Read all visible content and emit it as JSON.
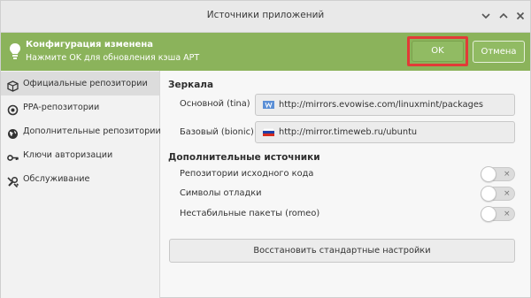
{
  "window": {
    "title": "Источники приложений"
  },
  "infobar": {
    "heading": "Конфигурация изменена",
    "message": "Нажмите OK для обновления кэша APT",
    "ok_label": "OK",
    "cancel_label": "Отмена",
    "color": "#8bb35b",
    "highlight_color": "#e23b37"
  },
  "sidebar": {
    "items": [
      {
        "label": "Официальные репозитории",
        "icon": "box-icon",
        "active": true
      },
      {
        "label": "PPA-репозитории",
        "icon": "target-icon",
        "active": false
      },
      {
        "label": "Дополнительные репозитории",
        "icon": "globe-icon",
        "active": false
      },
      {
        "label": "Ключи авторизации",
        "icon": "key-icon",
        "active": false
      },
      {
        "label": "Обслуживание",
        "icon": "tools-icon",
        "active": false
      }
    ]
  },
  "mirrors": {
    "title": "Зеркала",
    "main_label": "Основной (tina)",
    "main_url": "http://mirrors.evowise.com/linuxmint/packages",
    "base_label": "Базовый (bionic)",
    "base_url": "http://mirror.timeweb.ru/ubuntu"
  },
  "sources": {
    "title": "Дополнительные источники",
    "options": [
      {
        "label": "Репозитории исходного кода",
        "enabled": false
      },
      {
        "label": "Символы отладки",
        "enabled": false
      },
      {
        "label": "Нестабильные пакеты (romeo)",
        "enabled": false
      }
    ],
    "toggle_off_glyph": "×"
  },
  "restore_label": "Восстановить стандартные настройки"
}
